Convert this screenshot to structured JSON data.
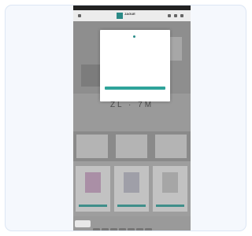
{
  "store": {
    "announcement": "",
    "logo_text": "JAGUE",
    "logo_sub": ""
  },
  "hero": {
    "big_text": "ZL · 7M"
  },
  "sections": {
    "title": "",
    "footer_text": ""
  },
  "cookie_button": "",
  "modal": {
    "title": "",
    "paragraphs": [
      "",
      "",
      ""
    ],
    "accept_button": "",
    "link": ""
  },
  "colors": {
    "accent": "#2fa39a",
    "overlay": "#9a9a9a"
  }
}
